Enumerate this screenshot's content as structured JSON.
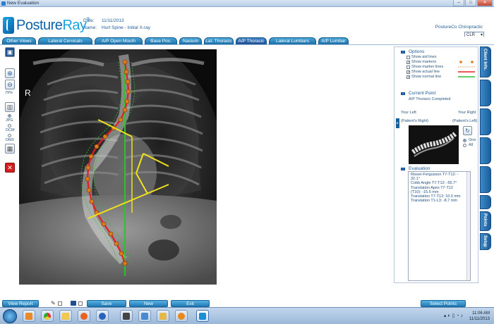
{
  "window": {
    "title": "New Evaluation",
    "controls": [
      "–",
      "□",
      "✕"
    ]
  },
  "logo": {
    "brand_left": "Posture",
    "brand_right": "Ray",
    "trademark": "®"
  },
  "patient": {
    "date_label": "Date:",
    "date_value": "11/11/2013",
    "name_label": "Name:",
    "name_value": "Hurt Spine - Initial X-ray"
  },
  "clinic": "PostureCo Chiropractic",
  "color_select": {
    "value": "CLR"
  },
  "tabs": [
    {
      "label": "Other Views"
    },
    {
      "label": "Lateral Cervicals"
    },
    {
      "label": "A/P Open Mouth"
    },
    {
      "label": "Base Pos."
    },
    {
      "label": "Nasium"
    },
    {
      "label": "Lat. Thoracic"
    },
    {
      "label": "A/P Thoracic",
      "active": true
    },
    {
      "label": "Lateral Lumbars"
    },
    {
      "label": "A/P Lumbar"
    }
  ],
  "left_tools": {
    "zoom_percent": "79%",
    "formats": [
      "JPG",
      "DCM",
      "DMX"
    ],
    "selected_format": "JPG"
  },
  "xray": {
    "side_marker": "R"
  },
  "options": {
    "title": "Options",
    "items": [
      {
        "label": "Show aid lines",
        "checked": false
      },
      {
        "label": "Show markers",
        "checked": true
      },
      {
        "label": "Show marker lines",
        "checked": false
      },
      {
        "label": "Show actual line",
        "checked": true
      },
      {
        "label": "Show normal line",
        "checked": true
      }
    ],
    "colors": {
      "markers": "#e07a1a",
      "marker_lines": "#e8a060",
      "actual_line": "#e02020",
      "normal_line": "#2ec02e"
    }
  },
  "current_point": {
    "title": "Current Point",
    "value": "A/P Thoracic Completed"
  },
  "orientation": {
    "left": "Your Left",
    "right": "Your Right",
    "patient_right": "(Patient's Right)",
    "patient_left": "(Patient's Left)",
    "view_options": [
      "One",
      "All"
    ],
    "selected_view": "One"
  },
  "evaluation": {
    "title": "Evaluation",
    "lines": [
      "Risser-Fergusson T7-T12: -",
      "32.1°",
      "Cobb Angle T7-T12: -55.7°",
      "Translation Apex T7-T12",
      "(T10): -15.5 mm",
      "Translation T7-T12: 10.0 mm",
      "Translation T1-L3: -8.7 mm"
    ]
  },
  "side_tabs": [
    {
      "label": "Client Info."
    },
    {
      "label": ""
    },
    {
      "label": ""
    },
    {
      "label": ""
    },
    {
      "label": ""
    },
    {
      "label": ""
    },
    {
      "label": "Points"
    },
    {
      "label": "Setup"
    }
  ],
  "bottom_buttons": {
    "view_report": "View Report",
    "save": "Save",
    "new": "New",
    "exit": "Exit",
    "select_points": "Select Points"
  },
  "taskbar": {
    "time": "11:06 AM",
    "date": "11/11/2013"
  }
}
